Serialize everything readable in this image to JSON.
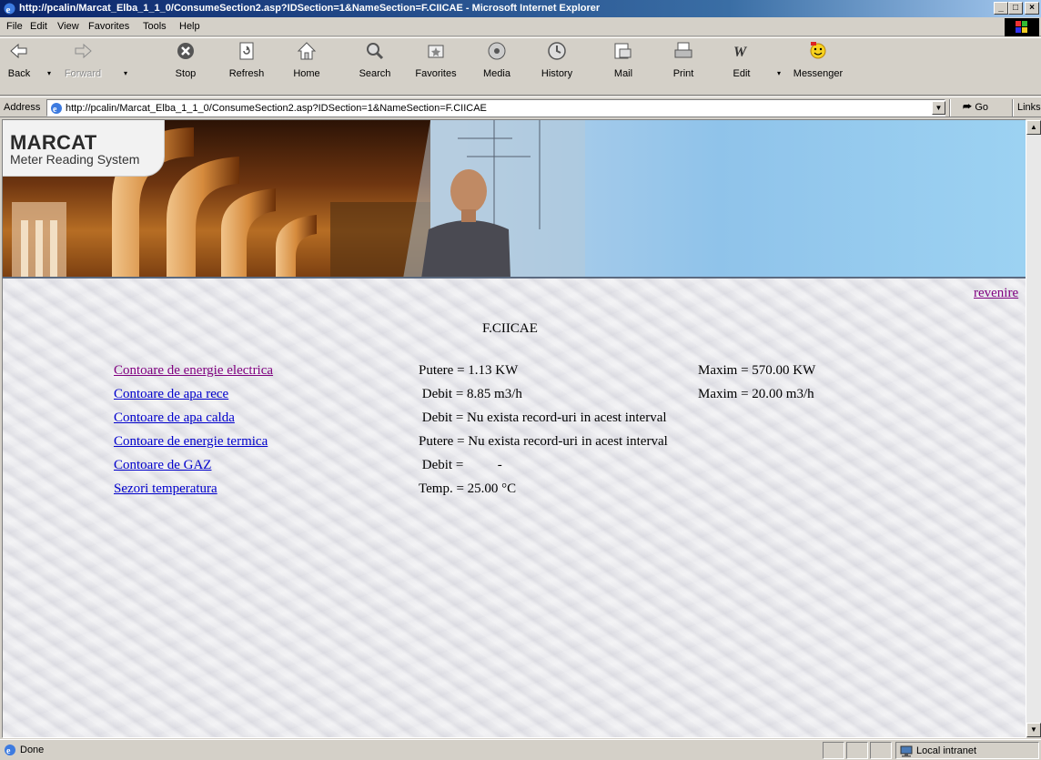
{
  "window": {
    "title": "http://pcalin/Marcat_Elba_1_1_0/ConsumeSection2.asp?IDSection=1&NameSection=F.CIICAE - Microsoft Internet Explorer"
  },
  "menu": [
    "File",
    "Edit",
    "View",
    "Favorites",
    "Tools",
    "Help"
  ],
  "toolbar": {
    "back": "Back",
    "forward": "Forward",
    "stop": "Stop",
    "refresh": "Refresh",
    "home": "Home",
    "search": "Search",
    "favorites": "Favorites",
    "media": "Media",
    "history": "History",
    "mail": "Mail",
    "print": "Print",
    "edit": "Edit",
    "messenger": "Messenger"
  },
  "address": {
    "label": "Address",
    "url": "http://pcalin/Marcat_Elba_1_1_0/ConsumeSection2.asp?IDSection=1&NameSection=F.CIICAE",
    "go": "Go",
    "links": "Links"
  },
  "page": {
    "logo_title": "MARCAT",
    "logo_subtitle": "Meter Reading System",
    "back_link": "revenire",
    "section_title": "F.CIICAE",
    "rows": [
      {
        "link": "Contoare de energie electrica",
        "value": "Putere = 1.13 KW",
        "max": "Maxim = 570.00 KW"
      },
      {
        "link": "Contoare de apa rece",
        "value": " Debit = 8.85 m3/h",
        "max": "Maxim = 20.00 m3/h"
      },
      {
        "link": "Contoare de apa calda",
        "value": " Debit = Nu exista record-uri in acest interval",
        "max": ""
      },
      {
        "link": "Contoare de energie termica",
        "value": "Putere = Nu exista record-uri in acest interval",
        "max": ""
      },
      {
        "link": "Contoare de GAZ",
        "value": " Debit =          -",
        "max": ""
      },
      {
        "link": "Sezori temperatura",
        "value": "Temp. = 25.00 °C",
        "max": ""
      }
    ]
  },
  "status": {
    "text": "Done",
    "zone": "Local intranet"
  }
}
